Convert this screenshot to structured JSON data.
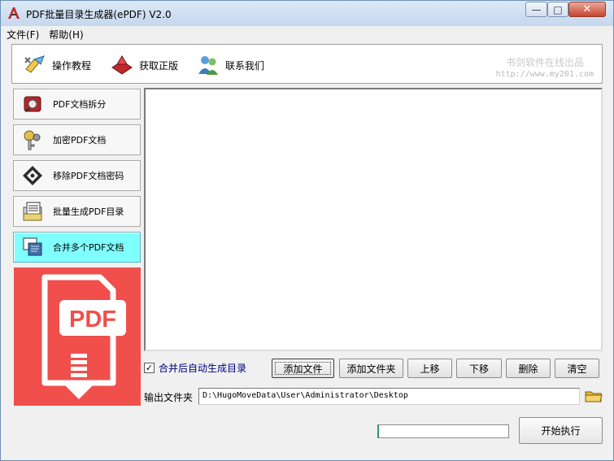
{
  "window": {
    "title": "PDF批量目录生成器(ePDF) V2.0",
    "controls": {
      "minimize": "—",
      "maximize": "□",
      "close": "✕"
    }
  },
  "menu": [
    "文件(F)",
    "帮助(H)"
  ],
  "toolbar": {
    "items": [
      {
        "label": "操作教程",
        "icon": "tutorial-icon"
      },
      {
        "label": "获取正版",
        "icon": "purchase-icon"
      },
      {
        "label": "联系我们",
        "icon": "contact-icon"
      }
    ],
    "brand_name": "书剑软件在线出品",
    "brand_url": "http://www.my201.com"
  },
  "nav": [
    {
      "label": "PDF文档拆分",
      "icon": "split-pdf-icon",
      "active": false
    },
    {
      "label": "加密PDF文档",
      "icon": "encrypt-key-icon",
      "active": false
    },
    {
      "label": "移除PDF文档密码",
      "icon": "remove-password-icon",
      "active": false
    },
    {
      "label": "批量生成PDF目录",
      "icon": "generate-toc-icon",
      "active": false
    },
    {
      "label": "合并多个PDF文档",
      "icon": "merge-pdf-icon",
      "active": true
    }
  ],
  "pdf_graphic_text": "PDF",
  "options": {
    "auto_toc_label": "合并后自动生成目录",
    "auto_toc_checked": true,
    "check_mark": "✓"
  },
  "actions": {
    "add_file": "添加文件",
    "add_folder": "添加文件夹",
    "move_up": "上移",
    "move_down": "下移",
    "delete": "删除",
    "clear": "清空"
  },
  "output": {
    "label": "输出文件夹",
    "path": "D:\\HugoMoveData\\User\\Administrator\\Desktop"
  },
  "progress_percent": 0,
  "start_label": "开始执行",
  "colors": {
    "active_nav": "#80ffff",
    "pdf_red": "#f04f4b",
    "checkbox_label": "#000080"
  }
}
